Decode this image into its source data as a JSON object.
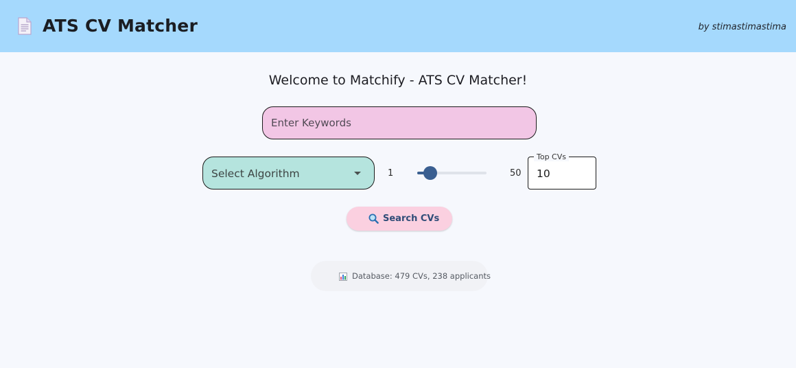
{
  "header": {
    "title": "ATS CV Matcher",
    "byline": "by stimastimastima",
    "icon": "document-icon",
    "background": "#a5d9fd"
  },
  "main": {
    "welcome": "Welcome to Matchify - ATS CV Matcher!",
    "keywords": {
      "placeholder": "Enter Keywords",
      "value": ""
    },
    "algorithm": {
      "placeholder": "Select Algorithm",
      "icon": "chevron-down-icon"
    },
    "top_cvs": {
      "min_label": "1",
      "max_label": "50",
      "min": 1,
      "max": 50,
      "value": 10,
      "field_label": "Top CVs",
      "field_value": "10"
    },
    "search_button": {
      "label": "Search CVs",
      "icon": "magnifier-icon"
    },
    "database": {
      "icon": "bar-chart-icon",
      "text": "Database: 479 CVs, 238 applicants"
    }
  },
  "colors": {
    "page_background": "#f6f8fd",
    "keywords_field": "#f2c6e5",
    "algorithm_field": "#b5e4de",
    "slider": "#3a5f91",
    "search_button": "#fbd0e0",
    "search_text": "#2f4c77"
  }
}
